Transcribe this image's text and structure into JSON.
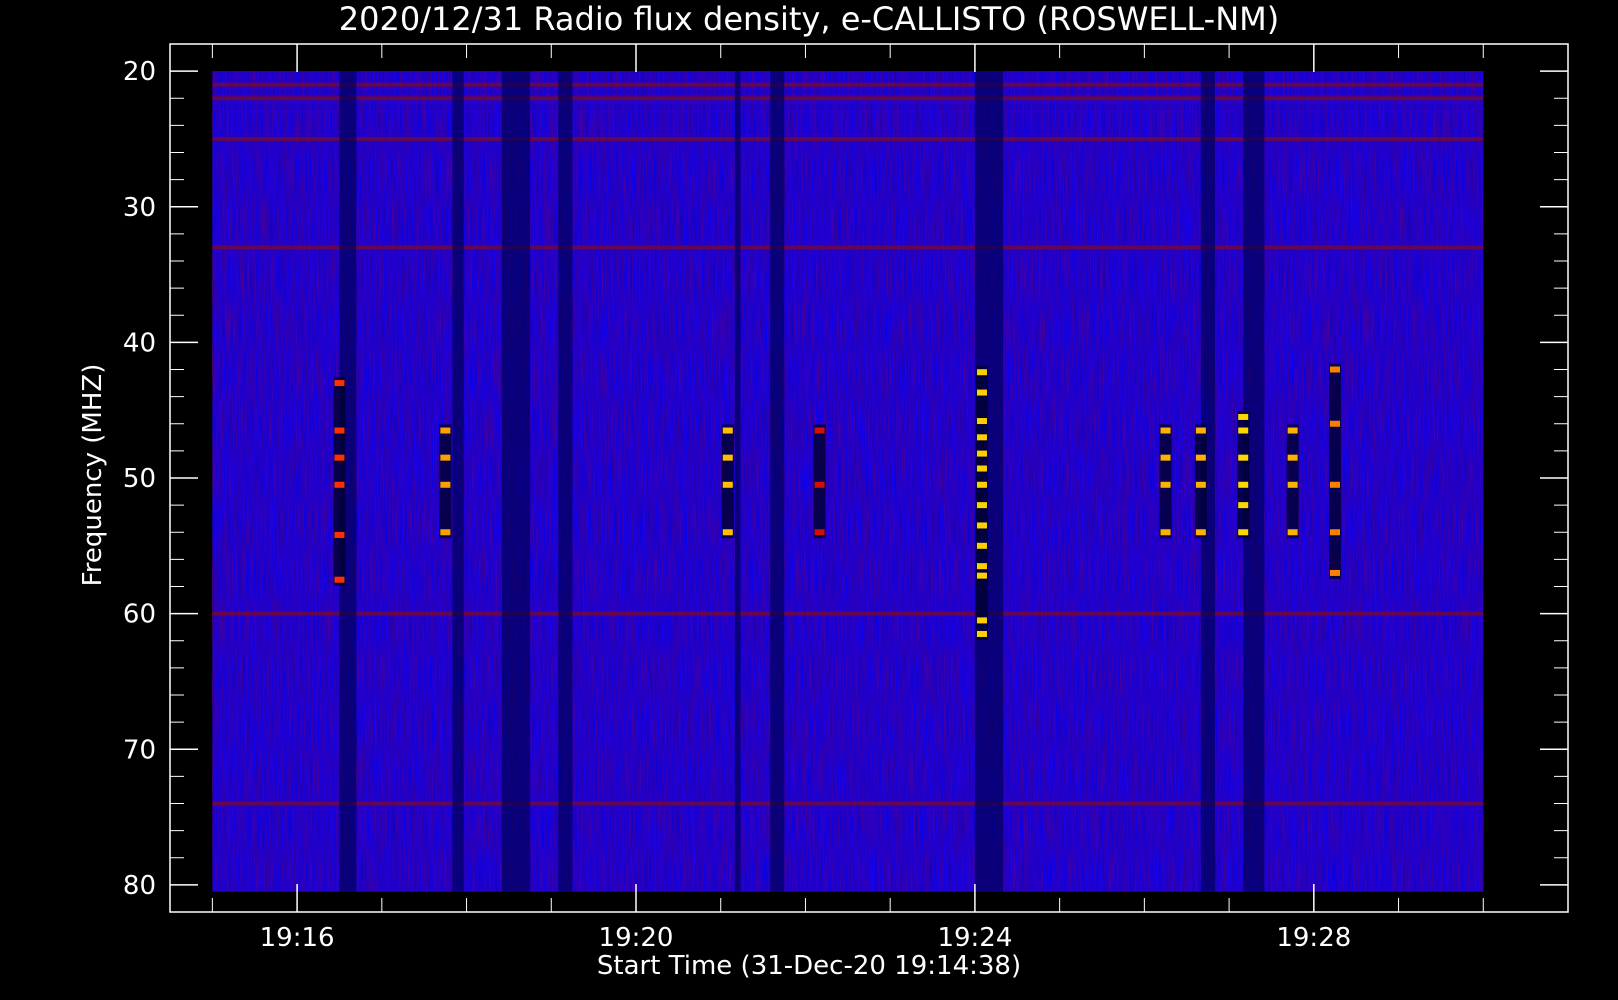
{
  "chart_data": {
    "type": "heatmap",
    "title": "2020/12/31  Radio flux density, e-CALLISTO (ROSWELL-NM)",
    "xlabel": "Start Time (31-Dec-20 19:14:38)",
    "ylabel": "Frequency (MHZ)",
    "x_range": [
      "19:14:30",
      "19:31:00"
    ],
    "x_ticks": [
      "19:16",
      "19:20",
      "19:24",
      "19:28"
    ],
    "x_data_extent": [
      "19:15:00",
      "19:30:00"
    ],
    "ylim": [
      82,
      18
    ],
    "y_ticks": [
      20,
      30,
      40,
      50,
      60,
      70,
      80
    ],
    "y_data_extent": [
      20,
      80.5
    ],
    "colormap": [
      "#000000",
      "#0000ff",
      "#8b0000",
      "#ff0000",
      "#ffd700"
    ],
    "background_color": "#0000ff",
    "horizontal_lines_mhz": [
      21,
      22,
      25,
      33,
      60,
      74
    ],
    "dark_vertical_bands": [
      {
        "start": "19:16:30",
        "end": "19:16:42"
      },
      {
        "start": "19:17:50",
        "end": "19:17:58"
      },
      {
        "start": "19:18:25",
        "end": "19:18:45"
      },
      {
        "start": "19:19:05",
        "end": "19:19:15"
      },
      {
        "start": "19:21:10",
        "end": "19:21:14"
      },
      {
        "start": "19:21:35",
        "end": "19:21:45"
      },
      {
        "start": "19:24:00",
        "end": "19:24:20"
      },
      {
        "start": "19:26:40",
        "end": "19:26:50"
      },
      {
        "start": "19:27:10",
        "end": "19:27:25"
      }
    ],
    "bursts": [
      {
        "time": "19:16:30",
        "freqs": [
          43,
          46.5,
          48.5,
          50.5,
          54.2,
          57.5
        ],
        "color": "#ff3000"
      },
      {
        "time": "19:17:45",
        "freqs": [
          46.5,
          48.5,
          50.5,
          54
        ],
        "color": "#ffa000"
      },
      {
        "time": "19:21:05",
        "freqs": [
          46.5,
          48.5,
          50.5,
          54
        ],
        "color": "#ffc000"
      },
      {
        "time": "19:22:10",
        "freqs": [
          46.5,
          50.5,
          54
        ],
        "color": "#d01000"
      },
      {
        "time": "19:24:05",
        "freqs": [
          42.2,
          43.7,
          45.8,
          47,
          48.2,
          49.3,
          50.5,
          52,
          53.5,
          55,
          56.5,
          57.2,
          60.5,
          61.5
        ],
        "color": "#ffd000"
      },
      {
        "time": "19:26:15",
        "freqs": [
          46.5,
          48.5,
          50.5,
          54
        ],
        "color": "#ffb000"
      },
      {
        "time": "19:26:40",
        "freqs": [
          46.5,
          48.5,
          50.5,
          54
        ],
        "color": "#ffb000"
      },
      {
        "time": "19:27:10",
        "freqs": [
          45.5,
          46.5,
          48.5,
          50.5,
          52,
          54
        ],
        "color": "#ffd700"
      },
      {
        "time": "19:27:45",
        "freqs": [
          46.5,
          48.5,
          50.5,
          54
        ],
        "color": "#ffb000"
      },
      {
        "time": "19:28:15",
        "freqs": [
          42,
          46,
          50.5,
          54,
          57
        ],
        "color": "#ff8000"
      }
    ]
  }
}
